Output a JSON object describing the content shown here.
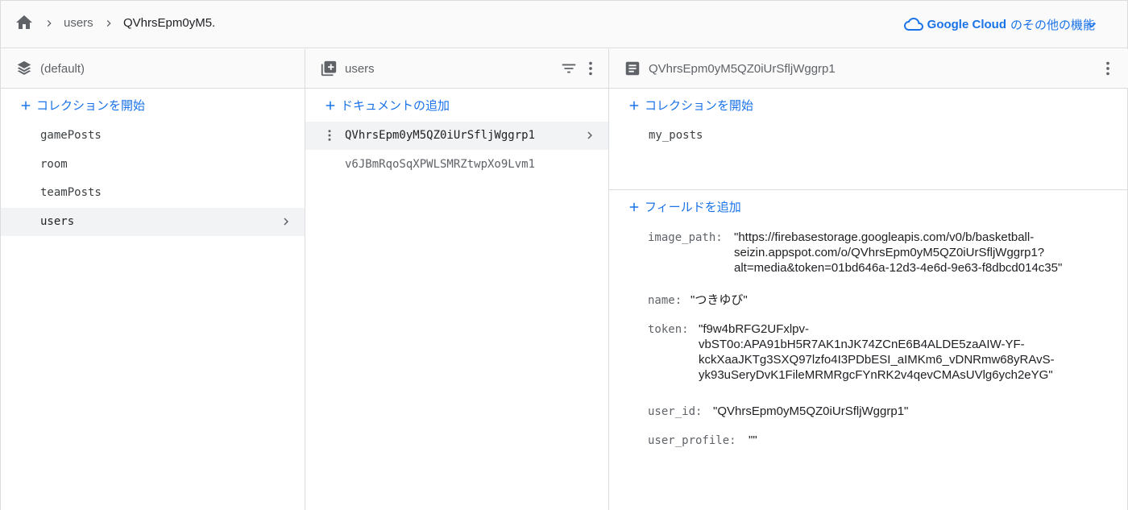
{
  "breadcrumb": {
    "items": [
      "users",
      "QVhrsEpm0yM5."
    ]
  },
  "cloud": {
    "brand": "Google Cloud",
    "suffix": "のその他の機能"
  },
  "colors": {
    "accent": "#1a73e8",
    "selected_bg": "#f1f3f4",
    "header_bg": "#fafafa",
    "border": "#dadce0"
  },
  "col1": {
    "title": "(default)",
    "add_label": "コレクションを開始",
    "items": [
      "gamePosts",
      "room",
      "teamPosts",
      "users"
    ],
    "selected_index": 3
  },
  "col2": {
    "title": "users",
    "add_label": "ドキュメントの追加",
    "items": [
      "QVhrsEpm0yM5QZ0iUrSfljWggrp1",
      "v6JBmRqoSqXPWLSMRZtwpXo9Lvm1"
    ],
    "selected_index": 0
  },
  "col3": {
    "title": "QVhrsEpm0yM5QZ0iUrSfljWggrp1",
    "add_collection_label": "コレクションを開始",
    "subcollections": [
      "my_posts"
    ],
    "add_field_label": "フィールドを追加",
    "fields": [
      {
        "key": "image_path:",
        "lines": [
          "\"https://firebasestorage.googleapis.com/v0/b/basketball-",
          "seizin.appspot.com/o/QVhrsEpm0yM5QZ0iUrSfljWggrp1?",
          "alt=media&token=01bd646a-12d3-4e6d-9e63-f8dbcd014c35\""
        ]
      },
      {
        "key": "name:",
        "lines": [
          "\"つきゆび\""
        ]
      },
      {
        "key": "token:",
        "lines": [
          "\"f9w4bRFG2UFxlpv-",
          "vbST0o:APA91bH5R7AK1nJK74ZCnE6B4ALDE5zaAIW-YF-",
          "kckXaaJKTg3SXQ97lzfo4I3PDbESI_aIMKm6_vDNRmw68yRAvS-",
          "yk93uSeryDvK1FileMRMRgcFYnRK2v4qevCMAsUVlg6ych2eYG\""
        ]
      },
      {
        "key": "user_id:",
        "lines": [
          "\"QVhrsEpm0yM5QZ0iUrSfljWggrp1\""
        ]
      },
      {
        "key": "user_profile:",
        "lines": [
          "\"\""
        ]
      }
    ]
  }
}
